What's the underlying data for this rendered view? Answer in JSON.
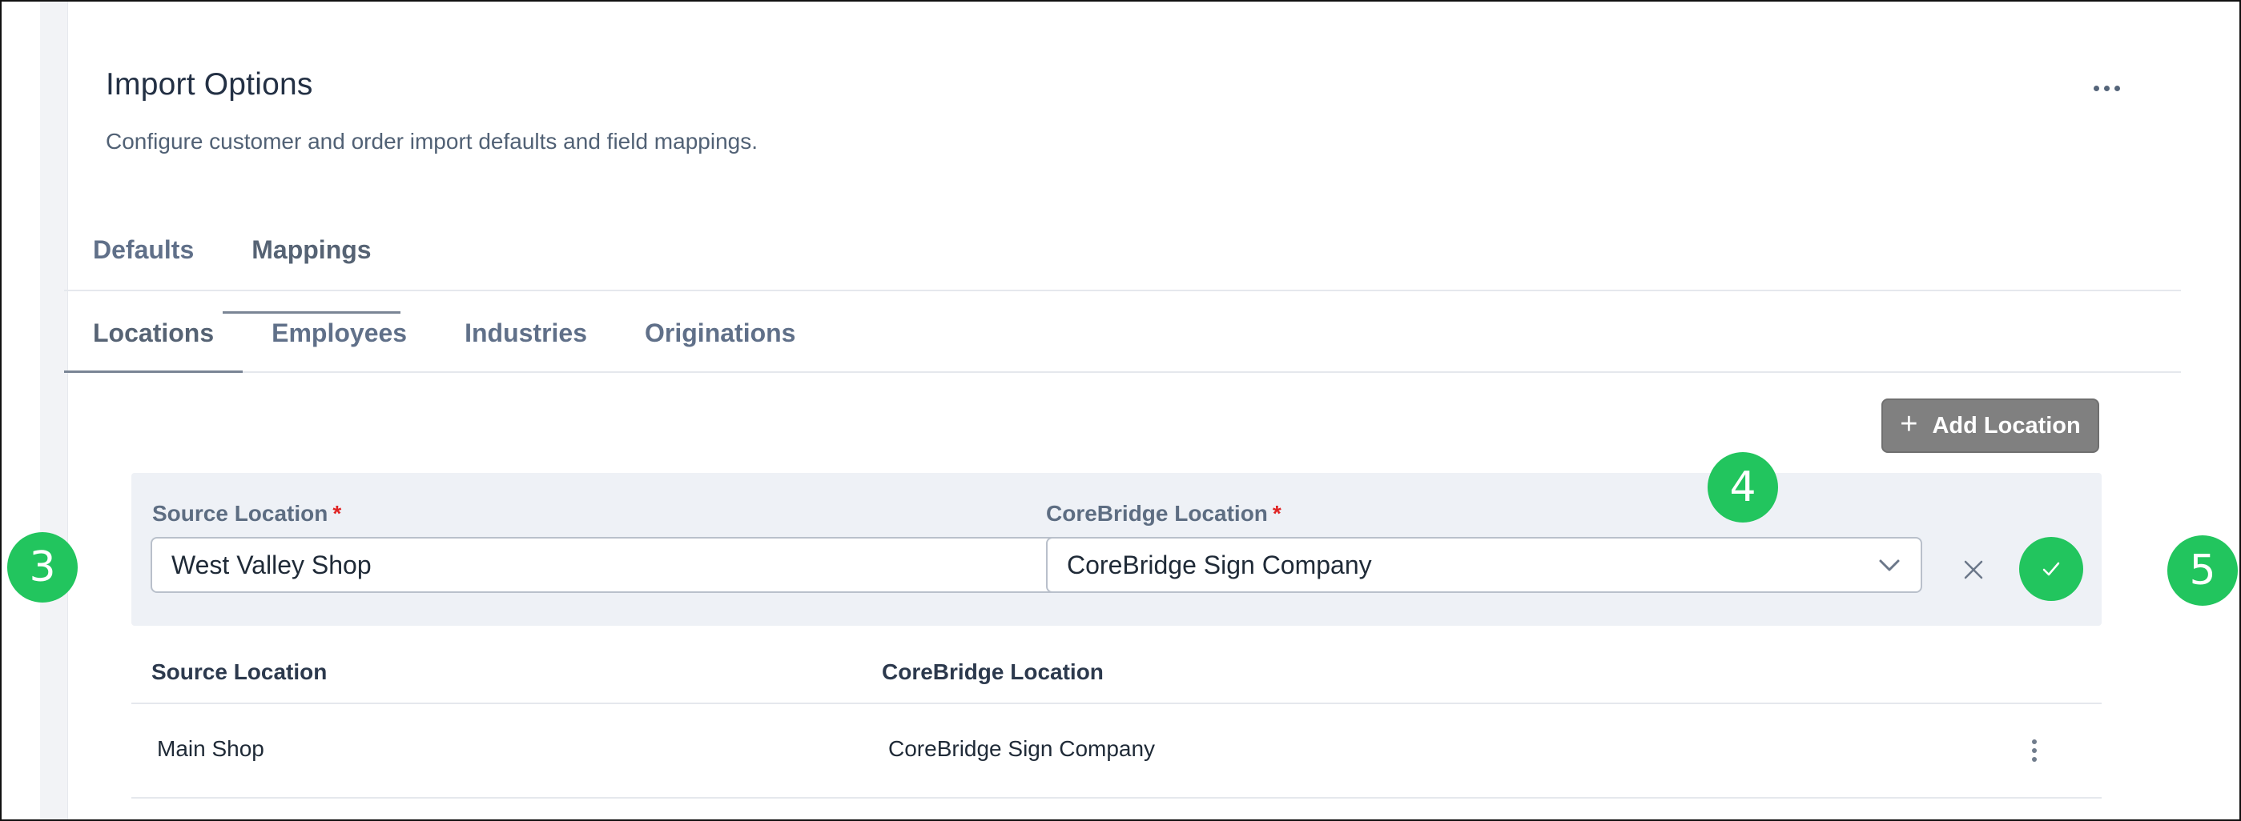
{
  "header": {
    "title": "Import Options",
    "subtitle": "Configure customer and order import defaults and field mappings."
  },
  "tabs_primary": [
    {
      "label": "Defaults",
      "active": false
    },
    {
      "label": "Mappings",
      "active": true
    }
  ],
  "tabs_secondary": [
    {
      "label": "Locations",
      "active": true
    },
    {
      "label": "Employees",
      "active": false
    },
    {
      "label": "Industries",
      "active": false
    },
    {
      "label": "Originations",
      "active": false
    }
  ],
  "add_button": {
    "label": "Add Location",
    "icon": "plus-icon"
  },
  "edit_row": {
    "source_label": "Source Location",
    "source_value": "West Valley Shop",
    "target_label": "CoreBridge Location",
    "target_value": "CoreBridge Sign Company",
    "required_marker": "*"
  },
  "table": {
    "columns": [
      "Source Location",
      "CoreBridge Location"
    ],
    "rows": [
      {
        "source": "Main Shop",
        "target": "CoreBridge Sign Company"
      }
    ]
  },
  "badges": [
    "3",
    "4",
    "5"
  ],
  "colors": {
    "accent_green": "#22c55e",
    "required_red": "#e02424",
    "add_button_gray": "#808080",
    "edit_row_bg": "#eef1f6"
  }
}
